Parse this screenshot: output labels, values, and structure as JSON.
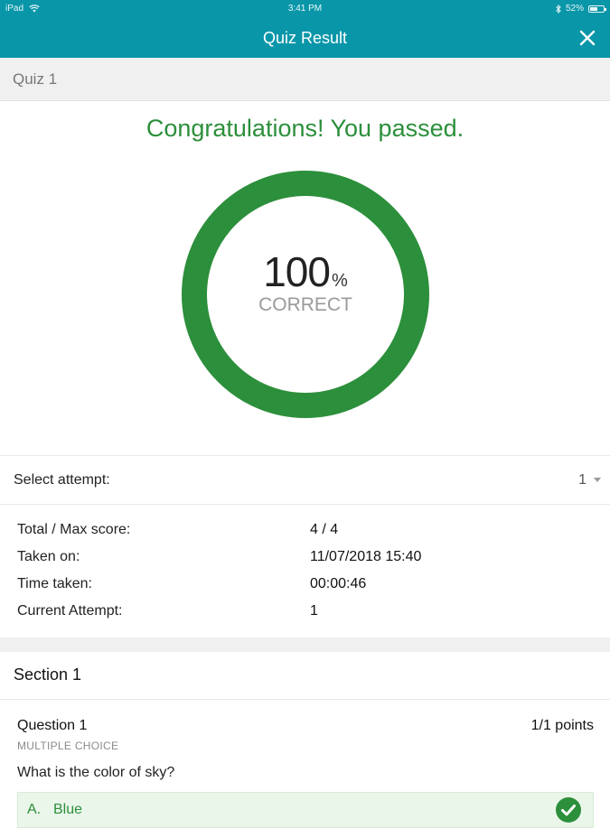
{
  "status_bar": {
    "device": "iPad",
    "time": "3:41 PM",
    "battery": "52%"
  },
  "nav": {
    "title": "Quiz Result"
  },
  "quiz": {
    "name": "Quiz 1"
  },
  "result": {
    "message": "Congratulations! You passed.",
    "percent": "100",
    "percent_unit": "%",
    "label": "CORRECT",
    "ring_fraction": 1.0,
    "ring_color": "#2c8f3b"
  },
  "attempt": {
    "label": "Select attempt:",
    "selected": "1"
  },
  "stats": [
    {
      "key": "Total / Max score:",
      "value": "4 / 4"
    },
    {
      "key": "Taken on:",
      "value": "11/07/2018 15:40"
    },
    {
      "key": "Time taken:",
      "value": "00:00:46"
    },
    {
      "key": "Current Attempt:",
      "value": "1"
    }
  ],
  "section": {
    "title": "Section 1"
  },
  "question": {
    "title": "Question 1",
    "points": "1/1 points",
    "type": "MULTIPLE CHOICE",
    "text": "What is the color of sky?",
    "answer": {
      "letter": "A.",
      "text": "Blue",
      "correct_icon": "check-circle-icon"
    }
  },
  "colors": {
    "header": "#0a96a9",
    "success": "#2c8f3b"
  }
}
